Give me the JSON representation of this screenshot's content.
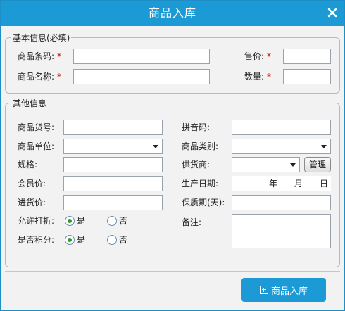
{
  "window": {
    "title": "商品入库"
  },
  "basic": {
    "legend": "基本信息(必填)",
    "barcode_label": "商品条码:",
    "name_label": "商品名称:",
    "price_label": "售价:",
    "qty_label": "数量:",
    "required_mark": "*"
  },
  "other": {
    "legend": "其他信息",
    "item_no_label": "商品货号:",
    "unit_label": "商品单位:",
    "spec_label": "规格:",
    "member_price_label": "会员价:",
    "purchase_price_label": "进货价:",
    "allow_discount_label": "允许打折:",
    "points_label": "是否积分:",
    "pinyin_label": "拼音码:",
    "category_label": "商品类别:",
    "supplier_label": "供货商:",
    "manage_button": "管理",
    "production_date_label": "生产日期:",
    "date_year": "年",
    "date_month": "月",
    "date_day": "日",
    "shelf_life_label": "保质期(天):",
    "remarks_label": "备注:",
    "yes": "是",
    "no": "否",
    "allow_discount_value": "是",
    "points_value": "是"
  },
  "footer": {
    "submit_label": "商品入库"
  },
  "colors": {
    "accent": "#1b9ad6",
    "required": "#d40000",
    "radio_checked": "#2a9a2a"
  },
  "icons": {
    "close": "close-icon",
    "submit": "plus-square-icon",
    "dropdown": "chevron-down-icon"
  }
}
